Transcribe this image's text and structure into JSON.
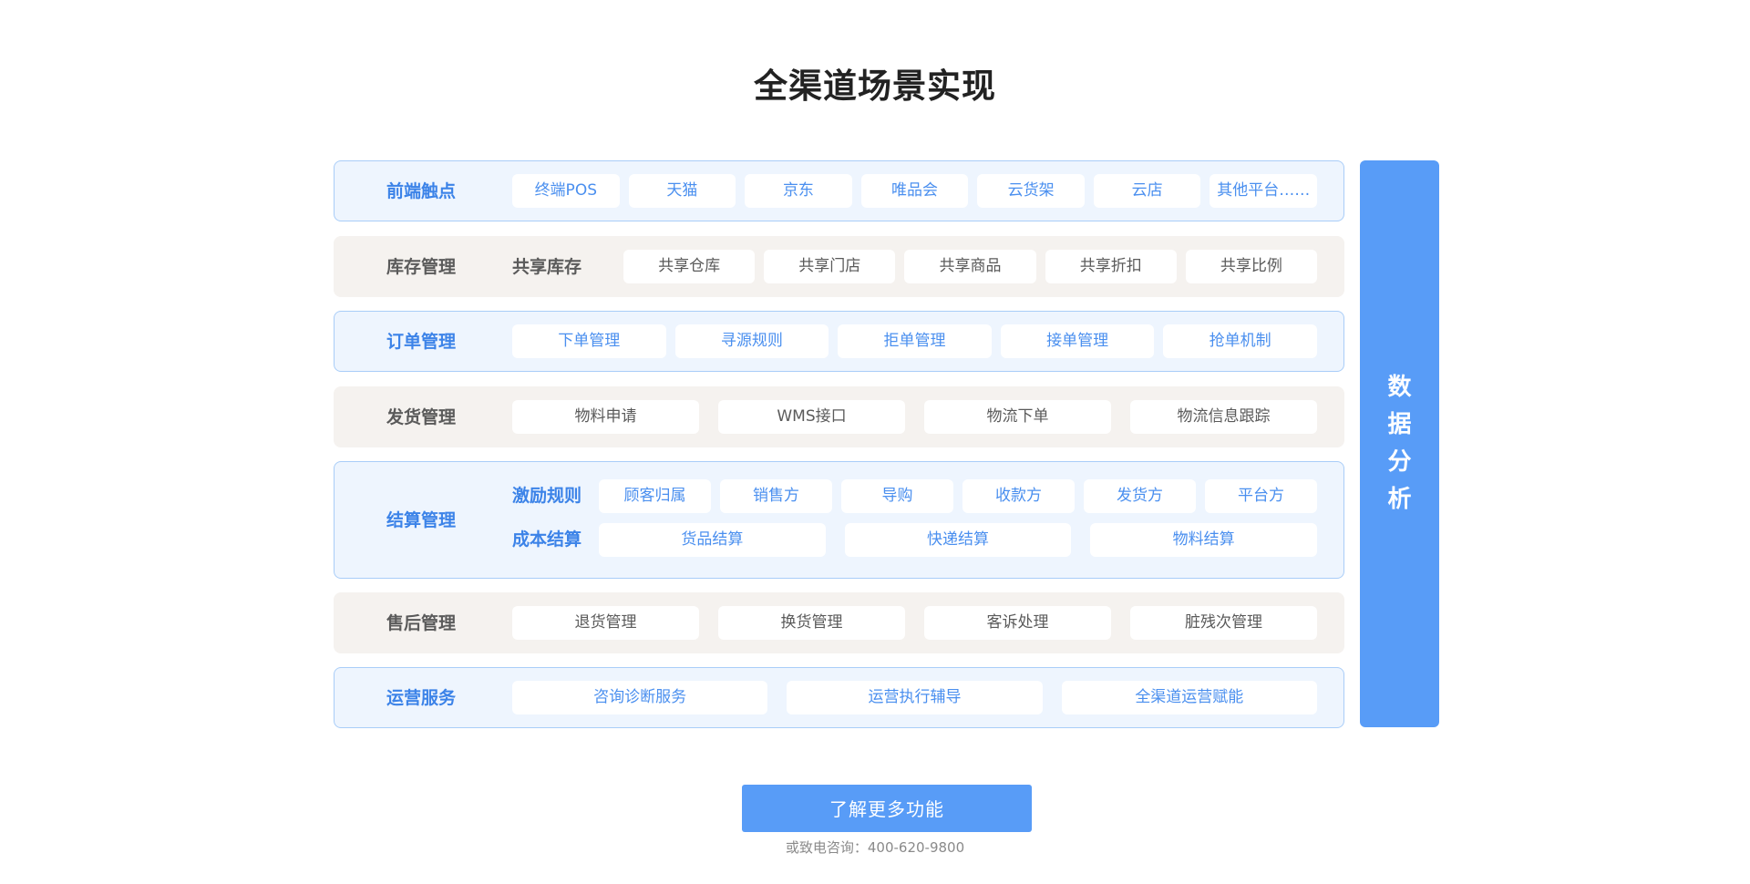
{
  "title": "全渠道场景实现",
  "side_panel": {
    "label": "数据分析"
  },
  "rows": [
    {
      "label": "前端触点",
      "items": [
        "终端POS",
        "天猫",
        "京东",
        "唯品会",
        "云货架",
        "云店",
        "其他平台……"
      ]
    },
    {
      "label": "库存管理",
      "sub_label": "共享库存",
      "items": [
        "共享仓库",
        "共享门店",
        "共享商品",
        "共享折扣",
        "共享比例"
      ]
    },
    {
      "label": "订单管理",
      "items": [
        "下单管理",
        "寻源规则",
        "拒单管理",
        "接单管理",
        "抢单机制"
      ]
    },
    {
      "label": "发货管理",
      "items": [
        "物料申请",
        "WMS接口",
        "物流下单",
        "物流信息跟踪"
      ]
    },
    {
      "label": "结算管理",
      "groups": [
        {
          "label": "激励规则",
          "items": [
            "顾客归属",
            "销售方",
            "导购",
            "收款方",
            "发货方",
            "平台方"
          ]
        },
        {
          "label": "成本结算",
          "items": [
            "货品结算",
            "快递结算",
            "物料结算"
          ]
        }
      ]
    },
    {
      "label": "售后管理",
      "items": [
        "退货管理",
        "换货管理",
        "客诉处理",
        "脏残次管理"
      ]
    },
    {
      "label": "运营服务",
      "items": [
        "咨询诊断服务",
        "运营执行辅导",
        "全渠道运营赋能"
      ]
    }
  ],
  "cta": {
    "label": "了解更多功能"
  },
  "contact": {
    "text": "或致电咨询：400-620-9800"
  }
}
